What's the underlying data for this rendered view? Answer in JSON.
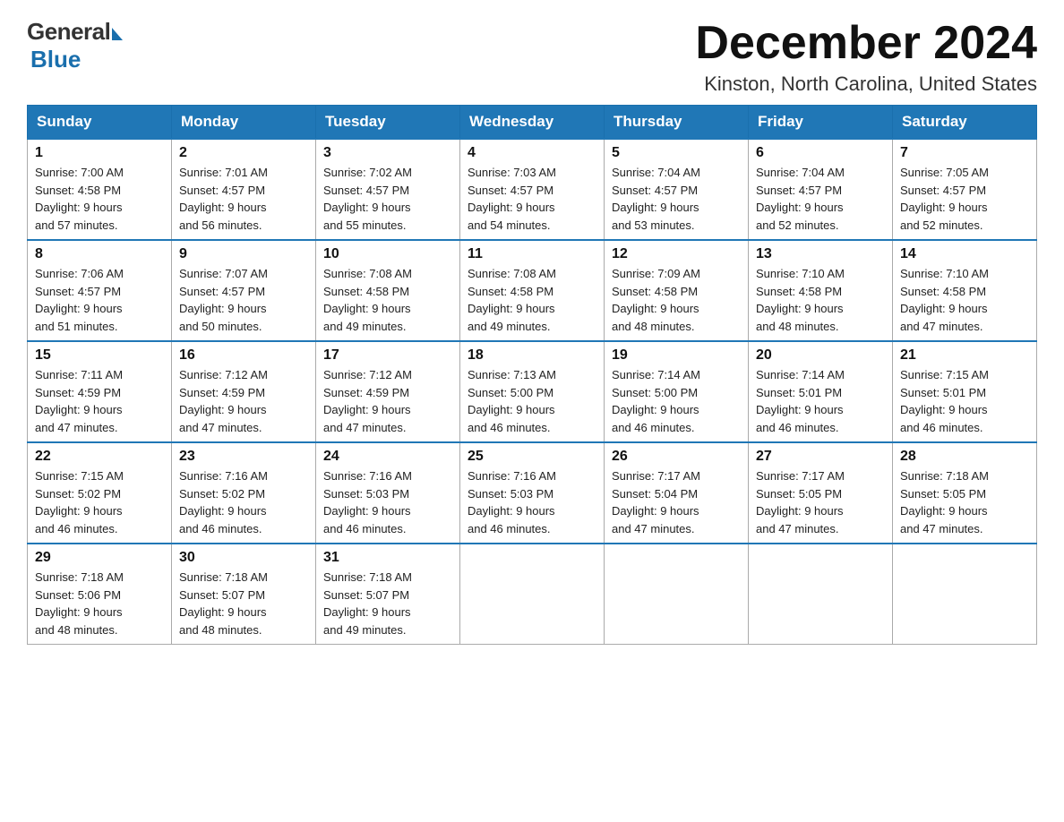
{
  "logo": {
    "general": "General",
    "blue": "Blue"
  },
  "title": {
    "month": "December 2024",
    "location": "Kinston, North Carolina, United States"
  },
  "days_of_week": [
    "Sunday",
    "Monday",
    "Tuesday",
    "Wednesday",
    "Thursday",
    "Friday",
    "Saturday"
  ],
  "weeks": [
    [
      {
        "day": "1",
        "sunrise": "7:00 AM",
        "sunset": "4:58 PM",
        "daylight": "9 hours and 57 minutes."
      },
      {
        "day": "2",
        "sunrise": "7:01 AM",
        "sunset": "4:57 PM",
        "daylight": "9 hours and 56 minutes."
      },
      {
        "day": "3",
        "sunrise": "7:02 AM",
        "sunset": "4:57 PM",
        "daylight": "9 hours and 55 minutes."
      },
      {
        "day": "4",
        "sunrise": "7:03 AM",
        "sunset": "4:57 PM",
        "daylight": "9 hours and 54 minutes."
      },
      {
        "day": "5",
        "sunrise": "7:04 AM",
        "sunset": "4:57 PM",
        "daylight": "9 hours and 53 minutes."
      },
      {
        "day": "6",
        "sunrise": "7:04 AM",
        "sunset": "4:57 PM",
        "daylight": "9 hours and 52 minutes."
      },
      {
        "day": "7",
        "sunrise": "7:05 AM",
        "sunset": "4:57 PM",
        "daylight": "9 hours and 52 minutes."
      }
    ],
    [
      {
        "day": "8",
        "sunrise": "7:06 AM",
        "sunset": "4:57 PM",
        "daylight": "9 hours and 51 minutes."
      },
      {
        "day": "9",
        "sunrise": "7:07 AM",
        "sunset": "4:57 PM",
        "daylight": "9 hours and 50 minutes."
      },
      {
        "day": "10",
        "sunrise": "7:08 AM",
        "sunset": "4:58 PM",
        "daylight": "9 hours and 49 minutes."
      },
      {
        "day": "11",
        "sunrise": "7:08 AM",
        "sunset": "4:58 PM",
        "daylight": "9 hours and 49 minutes."
      },
      {
        "day": "12",
        "sunrise": "7:09 AM",
        "sunset": "4:58 PM",
        "daylight": "9 hours and 48 minutes."
      },
      {
        "day": "13",
        "sunrise": "7:10 AM",
        "sunset": "4:58 PM",
        "daylight": "9 hours and 48 minutes."
      },
      {
        "day": "14",
        "sunrise": "7:10 AM",
        "sunset": "4:58 PM",
        "daylight": "9 hours and 47 minutes."
      }
    ],
    [
      {
        "day": "15",
        "sunrise": "7:11 AM",
        "sunset": "4:59 PM",
        "daylight": "9 hours and 47 minutes."
      },
      {
        "day": "16",
        "sunrise": "7:12 AM",
        "sunset": "4:59 PM",
        "daylight": "9 hours and 47 minutes."
      },
      {
        "day": "17",
        "sunrise": "7:12 AM",
        "sunset": "4:59 PM",
        "daylight": "9 hours and 47 minutes."
      },
      {
        "day": "18",
        "sunrise": "7:13 AM",
        "sunset": "5:00 PM",
        "daylight": "9 hours and 46 minutes."
      },
      {
        "day": "19",
        "sunrise": "7:14 AM",
        "sunset": "5:00 PM",
        "daylight": "9 hours and 46 minutes."
      },
      {
        "day": "20",
        "sunrise": "7:14 AM",
        "sunset": "5:01 PM",
        "daylight": "9 hours and 46 minutes."
      },
      {
        "day": "21",
        "sunrise": "7:15 AM",
        "sunset": "5:01 PM",
        "daylight": "9 hours and 46 minutes."
      }
    ],
    [
      {
        "day": "22",
        "sunrise": "7:15 AM",
        "sunset": "5:02 PM",
        "daylight": "9 hours and 46 minutes."
      },
      {
        "day": "23",
        "sunrise": "7:16 AM",
        "sunset": "5:02 PM",
        "daylight": "9 hours and 46 minutes."
      },
      {
        "day": "24",
        "sunrise": "7:16 AM",
        "sunset": "5:03 PM",
        "daylight": "9 hours and 46 minutes."
      },
      {
        "day": "25",
        "sunrise": "7:16 AM",
        "sunset": "5:03 PM",
        "daylight": "9 hours and 46 minutes."
      },
      {
        "day": "26",
        "sunrise": "7:17 AM",
        "sunset": "5:04 PM",
        "daylight": "9 hours and 47 minutes."
      },
      {
        "day": "27",
        "sunrise": "7:17 AM",
        "sunset": "5:05 PM",
        "daylight": "9 hours and 47 minutes."
      },
      {
        "day": "28",
        "sunrise": "7:18 AM",
        "sunset": "5:05 PM",
        "daylight": "9 hours and 47 minutes."
      }
    ],
    [
      {
        "day": "29",
        "sunrise": "7:18 AM",
        "sunset": "5:06 PM",
        "daylight": "9 hours and 48 minutes."
      },
      {
        "day": "30",
        "sunrise": "7:18 AM",
        "sunset": "5:07 PM",
        "daylight": "9 hours and 48 minutes."
      },
      {
        "day": "31",
        "sunrise": "7:18 AM",
        "sunset": "5:07 PM",
        "daylight": "9 hours and 49 minutes."
      },
      null,
      null,
      null,
      null
    ]
  ],
  "labels": {
    "sunrise": "Sunrise:",
    "sunset": "Sunset:",
    "daylight": "Daylight:"
  }
}
